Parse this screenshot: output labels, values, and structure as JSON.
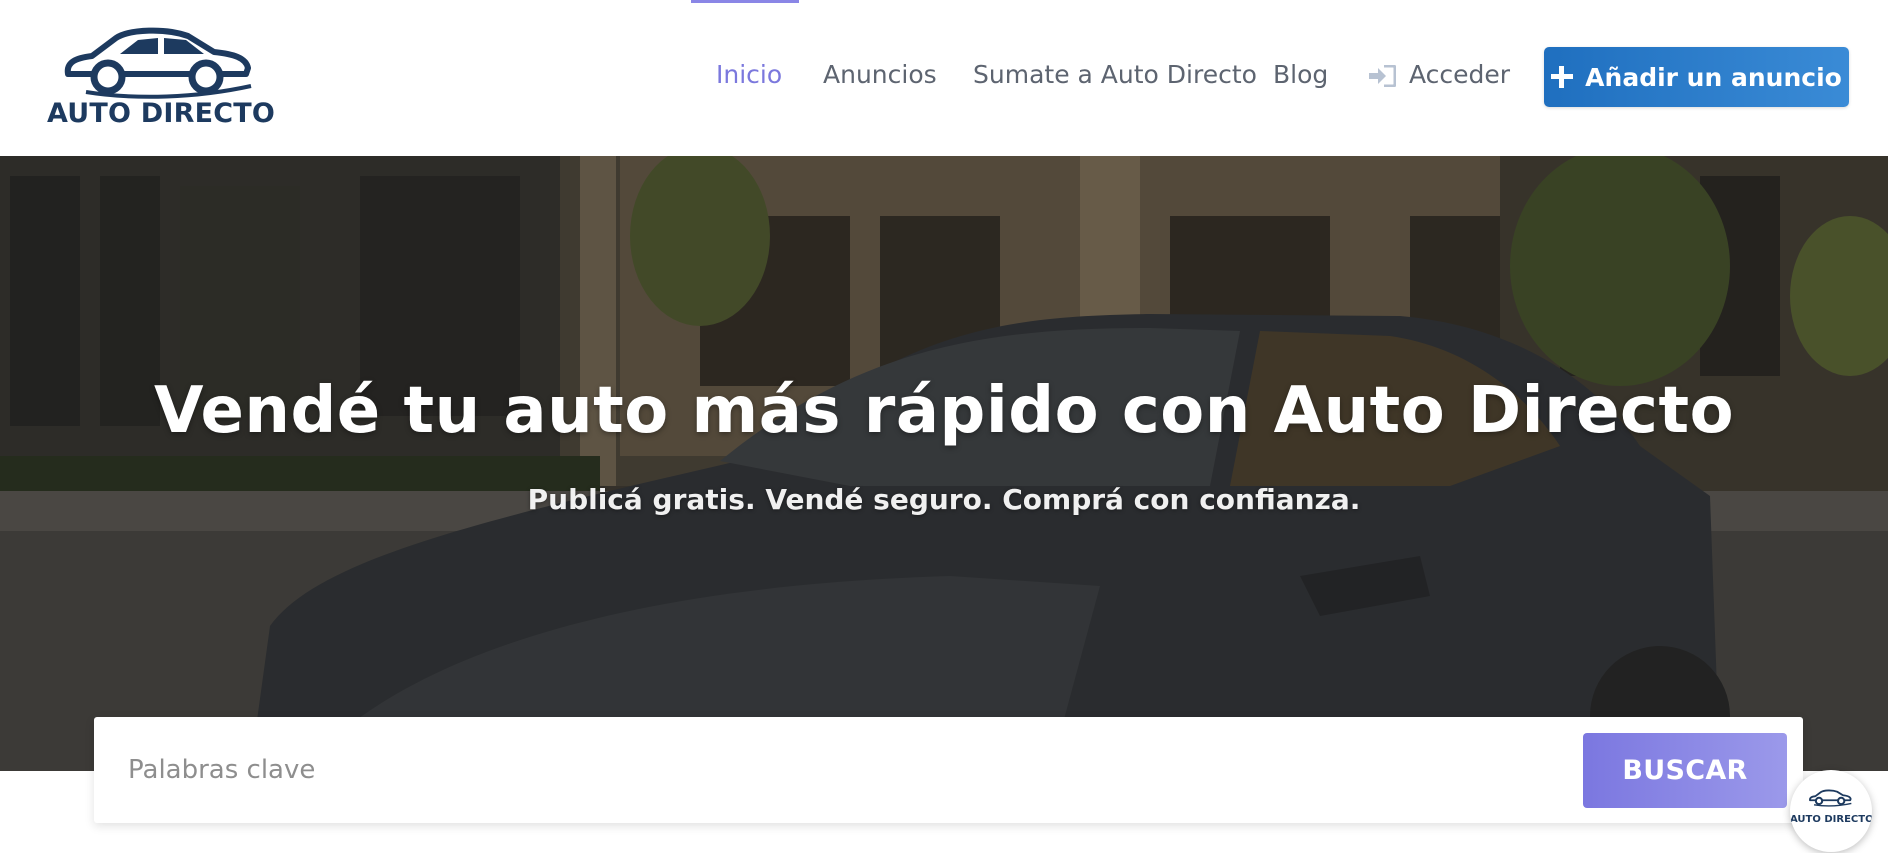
{
  "brand": {
    "name": "AUTO DIRECTO",
    "color": "#1d3a5f"
  },
  "nav": {
    "items": [
      {
        "label": "Inicio",
        "active": true
      },
      {
        "label": "Anuncios",
        "active": false
      },
      {
        "label": "Sumate a Auto Directo",
        "active": false
      },
      {
        "label": "Blog",
        "active": false
      },
      {
        "label": "Acceder",
        "active": false,
        "icon": "sign-in-icon"
      }
    ],
    "active_color": "#7b78dd"
  },
  "add_button": {
    "label": "Añadir un anuncio",
    "icon": "plus-icon",
    "color": "#1f6fbf"
  },
  "hero": {
    "title": "Vendé tu auto más rápido con Auto Directo",
    "subtitle": "Publicá gratis. Vendé seguro. Comprá con confianza."
  },
  "search": {
    "placeholder": "Palabras clave",
    "value": "",
    "button_label": "BUSCAR",
    "button_color": "#7b77e0"
  },
  "badge": {
    "label": "AUTO DIRECTO"
  }
}
